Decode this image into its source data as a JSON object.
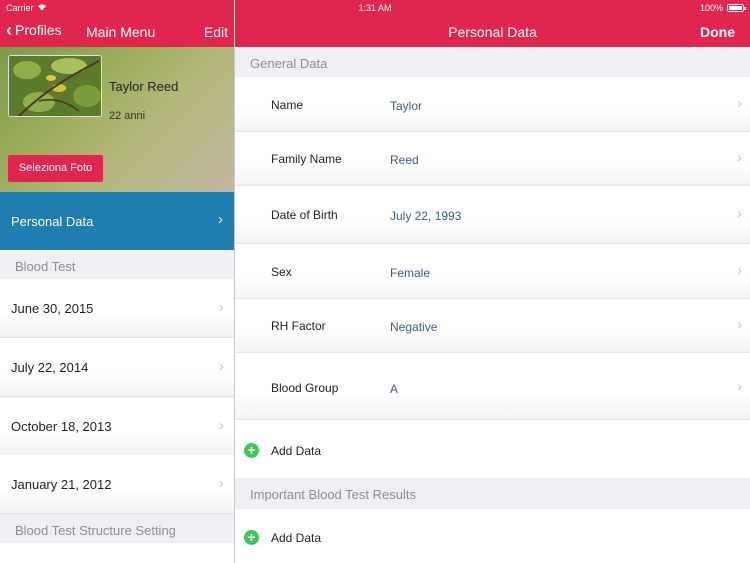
{
  "status_bar": {
    "carrier": "Carrier",
    "time": "1:31 AM",
    "battery": "100%"
  },
  "nav_left": {
    "back_label": "Profiles",
    "title": "Main Menu",
    "edit_label": "Edit"
  },
  "nav_right": {
    "title": "Personal Data",
    "done_label": "Done"
  },
  "profile": {
    "name": "Taylor Reed",
    "age": "22 anni",
    "photo_button": "Seleziona Foto"
  },
  "menu": {
    "personal_data": "Personal Data",
    "blood_test_header": "Blood Test",
    "blood_tests": [
      "June 30, 2015",
      "July 22, 2014",
      "October 18, 2013",
      "January 21, 2012"
    ],
    "structure_header": "Blood Test Structure Setting"
  },
  "general": {
    "header": "General Data",
    "fields": [
      {
        "label": "Name",
        "value": "Taylor"
      },
      {
        "label": "Family Name",
        "value": "Reed"
      },
      {
        "label": "Date of Birth",
        "value": "July 22, 1993"
      },
      {
        "label": "Sex",
        "value": "Female"
      },
      {
        "label": "RH Factor",
        "value": "Negative"
      },
      {
        "label": "Blood Group",
        "value": "A"
      }
    ],
    "add_label": "Add Data"
  },
  "important": {
    "header": "Important Blood Test Results",
    "add_label": "Add Data"
  },
  "colors": {
    "accent": "#e0264e",
    "selected": "#1f7eaf",
    "add_green": "#3cc85a",
    "value_text": "#3b5a94"
  }
}
